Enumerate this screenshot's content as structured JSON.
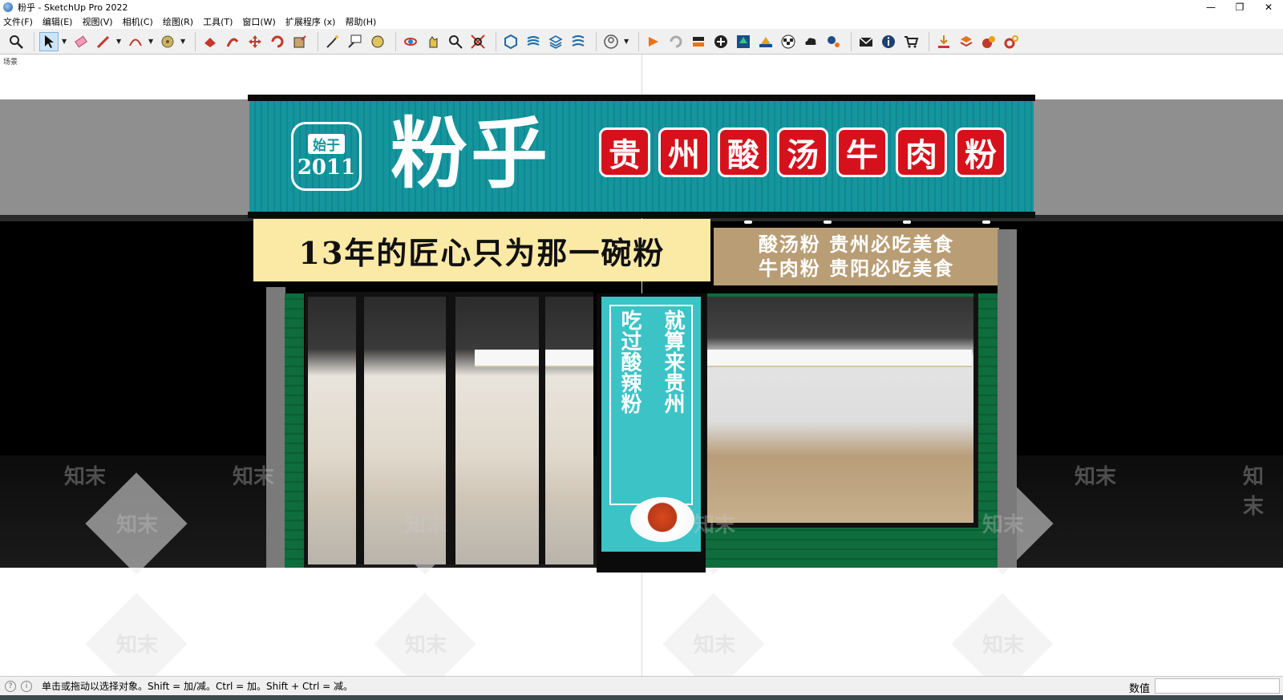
{
  "window": {
    "title": "粉乎 - SketchUp Pro 2022",
    "controls": [
      "—",
      "❐",
      "✕"
    ]
  },
  "menu": [
    "文件(F)",
    "编辑(E)",
    "视图(V)",
    "相机(C)",
    "绘图(R)",
    "工具(T)",
    "窗口(W)",
    "扩展程序 (x)",
    "帮助(H)"
  ],
  "toolbar": {
    "icons": [
      "zoom-icon",
      "select-icon",
      "eraser-icon",
      "pencil-icon",
      "arc-icon",
      "tape-icon",
      "paint-icon",
      "push-pull-icon",
      "move-icon",
      "rotate-icon",
      "scale-icon",
      "text-icon",
      "dimension-icon",
      "protractor-icon",
      "orbit-icon",
      "pan-icon",
      "zoom-window-icon",
      "zoom-extents-icon",
      "warehouse-icon",
      "extension-icon",
      "layer-icon",
      "section-icon",
      "user-icon",
      "render-icon",
      "refresh-icon",
      "send-icon",
      "add-icon",
      "tree-icon",
      "terrain-icon",
      "checker-icon",
      "cloud-icon",
      "settings-icon",
      "mail-icon",
      "info-icon",
      "cart-icon",
      "import-icon",
      "stack-icon",
      "texture-icon",
      "gear-icon"
    ]
  },
  "viewport": {
    "scene_tab": "场景"
  },
  "storefront": {
    "badge_top": "始于",
    "badge_year": "2011",
    "brand": "粉乎",
    "red_chars": [
      "贵",
      "州",
      "酸",
      "汤",
      "牛",
      "肉",
      "粉"
    ],
    "slogan": "13年的匠心只为那一碗粉",
    "side_line1": "酸汤粉 贵州必吃美食",
    "side_line2": "牛肉粉 贵阳必吃美食",
    "totem_col_right": "就算来贵州",
    "totem_col_left": "吃过酸辣粉",
    "watermark": "知末"
  },
  "status": {
    "hint": "单击或拖动以选择对象。Shift = 加/减。Ctrl = 加。Shift + Ctrl = 减。",
    "measure_label": "数值",
    "measure_value": ""
  },
  "colors": {
    "sign_teal": "#15959e",
    "red_box": "#d7111c",
    "slogan_bg": "#fbe9a6",
    "side_sign_bg": "#b99d74",
    "tile_green": "#0f6c3c"
  }
}
